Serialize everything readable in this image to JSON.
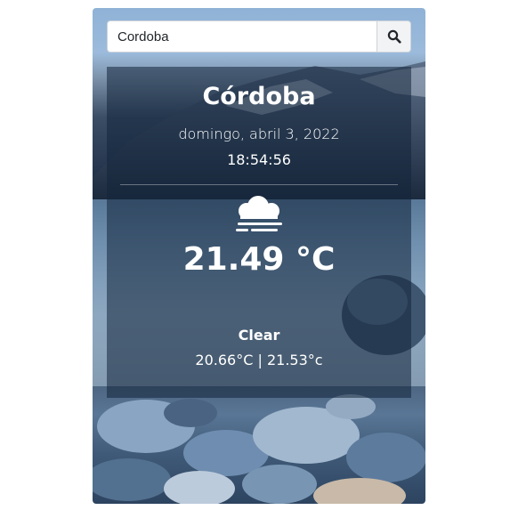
{
  "search": {
    "value": "Cordoba",
    "button_icon": "search-icon"
  },
  "weather": {
    "city": "Córdoba",
    "date": "domingo, abril 3, 2022",
    "time": "18:54:56",
    "icon": "fog-icon",
    "temperature": "21.49 °C",
    "condition": "Clear",
    "min_max": "20.66°C | 21.53°c"
  },
  "colors": {
    "panel_overlay": "#12243a",
    "text": "#ffffff",
    "input_border": "#ced4da",
    "button_bg": "#f1f3f5"
  }
}
